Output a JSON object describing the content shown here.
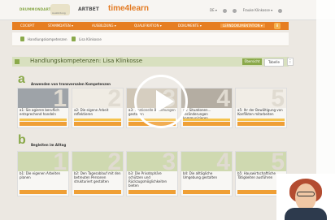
{
  "header": {
    "logo_left": "DRUMMONDARTIG",
    "logo_emblem": "Ausbildung",
    "brand_artbet": "ARTBET",
    "brand_timelearn": "time4learn",
    "lang": "DE ▾",
    "user": "Frauke Klinkosse ▾"
  },
  "nav": {
    "items": [
      "COCKPIT",
      "STAMMDATEN ▾",
      "AUSBILDUNG ▾",
      "QUALIFIKATION ▾",
      "DOKUMENTE ▾",
      "LERNDOKUMENTATION ▾"
    ],
    "counter": "8"
  },
  "breadcrumb": {
    "items": [
      "Handlungskompetenzen",
      "Lisa Klinkosse"
    ]
  },
  "section": {
    "title": "Handlungskompetenzen: Lisa Klinkosse",
    "toggle_on": "Übersicht",
    "toggle_off": "Tabelle",
    "menu_icon": "⋮"
  },
  "group_a": {
    "letter": "a",
    "title": "Anwenden von transversalen Kompetenzen",
    "cards": [
      {
        "num": "1",
        "label": "a1: Sie agieren beruflich entsprechend handeln"
      },
      {
        "num": "2",
        "label": "a2: Die eigene Arbeit reflektieren"
      },
      {
        "num": "3",
        "label": "a3: ...rationelle Beziehungen gestalten"
      },
      {
        "num": "4",
        "label": "a4: Situationen... Veränderungen kommunizieren"
      },
      {
        "num": "5",
        "label": "a5: Ihr der Bewältigung von Konflikten mitarbeiten"
      }
    ]
  },
  "group_b": {
    "letter": "b",
    "title": "Begleiten im Alltag",
    "cards": [
      {
        "num": "1",
        "label": "b1: Die eigenen Arbeiten planen"
      },
      {
        "num": "2",
        "label": "b2: Den Tagesablauf mit den betreuten Personen strukturiert gestalten"
      },
      {
        "num": "3",
        "label": "b3: Die Privatsphäre schützen und Rückzugsmöglichkeiten bieten"
      },
      {
        "num": "4",
        "label": "b4: Die alltägliche Umgebung gestalten"
      },
      {
        "num": "5",
        "label": "b5: Hauswirtschaftliche Tätigkeiten ausführen"
      }
    ]
  }
}
